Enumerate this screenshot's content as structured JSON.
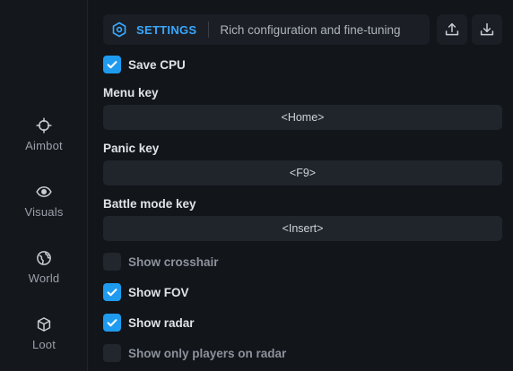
{
  "sidebar": {
    "items": [
      {
        "label": "Aimbot",
        "icon": "crosshair-icon"
      },
      {
        "label": "Visuals",
        "icon": "eye-icon"
      },
      {
        "label": "World",
        "icon": "globe-icon"
      },
      {
        "label": "Loot",
        "icon": "box-icon"
      }
    ]
  },
  "header": {
    "icon": "gear-icon",
    "title": "SETTINGS",
    "subtitle": "Rich configuration and fine-tuning",
    "export_icon": "upload-icon",
    "import_icon": "download-icon"
  },
  "settings": {
    "save_cpu": {
      "label": "Save CPU",
      "checked": true
    },
    "menu_key": {
      "label": "Menu key",
      "value": "<Home>"
    },
    "panic_key": {
      "label": "Panic key",
      "value": "<F9>"
    },
    "battle_mode_key": {
      "label": "Battle mode key",
      "value": "<Insert>"
    },
    "show_crosshair": {
      "label": "Show crosshair",
      "checked": false
    },
    "show_fov": {
      "label": "Show FOV",
      "checked": true
    },
    "show_radar": {
      "label": "Show radar",
      "checked": true
    },
    "show_only_players_on_radar": {
      "label": "Show only players on radar",
      "checked": false
    }
  },
  "colors": {
    "accent": "#1e9bef",
    "background": "#12151a",
    "panel": "#1b1f25"
  }
}
